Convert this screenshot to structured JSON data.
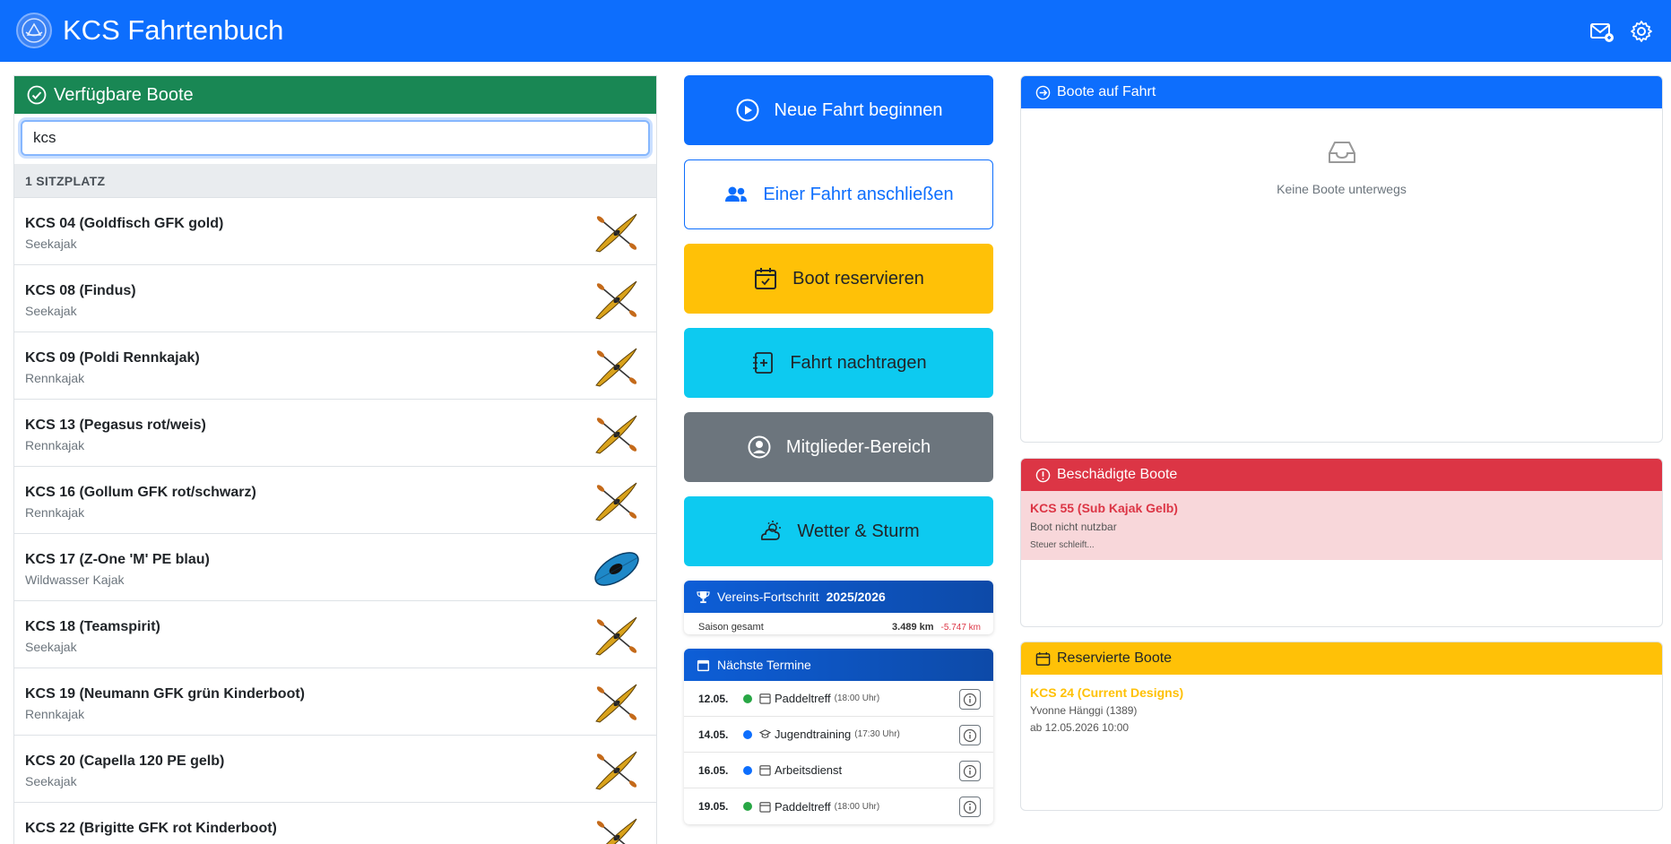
{
  "header": {
    "title": "KCS Fahrtenbuch",
    "icons": [
      "club-logo",
      "mail-icon",
      "gear-icon"
    ]
  },
  "available": {
    "title": "Verfügbare Boote",
    "search_value": "kcs",
    "group": "1 SITZPLATZ",
    "boats": [
      {
        "name": "KCS 04 (Goldfisch GFK gold)",
        "type": "Seekajak",
        "icon": "kayak-yellow"
      },
      {
        "name": "KCS 08 (Findus)",
        "type": "Seekajak",
        "icon": "kayak-yellow"
      },
      {
        "name": "KCS 09 (Poldi Rennkajak)",
        "type": "Rennkajak",
        "icon": "kayak-yellow"
      },
      {
        "name": "KCS 13 (Pegasus rot/weis)",
        "type": "Rennkajak",
        "icon": "kayak-yellow"
      },
      {
        "name": "KCS 16 (Gollum GFK rot/schwarz)",
        "type": "Rennkajak",
        "icon": "kayak-yellow"
      },
      {
        "name": "KCS 17 (Z-One 'M' PE blau)",
        "type": "Wildwasser Kajak",
        "icon": "kayak-blue"
      },
      {
        "name": "KCS 18 (Teamspirit)",
        "type": "Seekajak",
        "icon": "kayak-yellow"
      },
      {
        "name": "KCS 19 (Neumann GFK grün Kinderboot)",
        "type": "Rennkajak",
        "icon": "kayak-yellow"
      },
      {
        "name": "KCS 20 (Capella 120 PE gelb)",
        "type": "Seekajak",
        "icon": "kayak-yellow"
      },
      {
        "name": "KCS 22 (Brigitte GFK rot Kinderboot)",
        "type": "",
        "icon": "kayak-yellow"
      }
    ]
  },
  "actions": {
    "new_trip": "Neue Fahrt beginnen",
    "join_trip": "Einer Fahrt anschließen",
    "reserve": "Boot reservieren",
    "backfill": "Fahrt nachtragen",
    "members": "Mitglieder-Bereich",
    "weather": "Wetter & Sturm"
  },
  "progress": {
    "title": "Vereins-Fortschritt",
    "season": "2025/2026",
    "label": "Saison gesamt",
    "km": "3.489 km",
    "diff": "-5.747 km"
  },
  "events": {
    "title": "Nächste Termine",
    "items": [
      {
        "date": "12.05.",
        "title": "Paddeltreff",
        "time": "(18:00 Uhr)",
        "dot": "#28a745",
        "icon": "calendar-icon"
      },
      {
        "date": "14.05.",
        "title": "Jugendtraining",
        "time": "(17:30 Uhr)",
        "dot": "#0d6efd",
        "icon": "graduation-cap-icon"
      },
      {
        "date": "16.05.",
        "title": "Arbeitsdienst",
        "time": "",
        "dot": "#0d6efd",
        "icon": "calendar-icon"
      },
      {
        "date": "19.05.",
        "title": "Paddeltreff",
        "time": "(18:00 Uhr)",
        "dot": "#28a745",
        "icon": "calendar-icon"
      }
    ]
  },
  "on_trip": {
    "title": "Boote auf Fahrt",
    "empty": "Keine Boote unterwegs"
  },
  "damaged": {
    "title": "Beschädigte Boote",
    "name": "KCS 55 (Sub Kajak Gelb)",
    "status": "Boot nicht nutzbar",
    "comment": "Steuer schleift..."
  },
  "reserved": {
    "title": "Reservierte Boote",
    "name": "KCS 24 (Current Designs)",
    "person": "Yvonne Hänggi (1389)",
    "from": "ab 12.05.2026 10:00"
  },
  "colors": {
    "primary": "#0d6efd",
    "success": "#198754",
    "warning": "#ffc107",
    "info": "#0dcaf0",
    "secondary": "#6c757d",
    "danger": "#dc3545"
  }
}
